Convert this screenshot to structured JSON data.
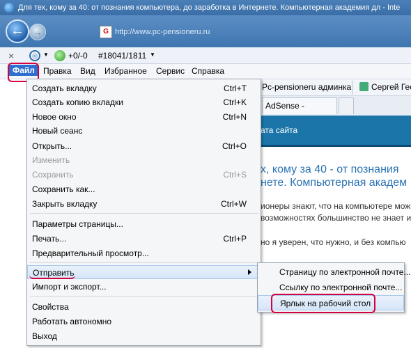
{
  "window": {
    "title": "Для тех, кому за 40: от познания компьютера, до заработка в Интернете. Компьютерная академия дл - Inte",
    "address": "http://www.pc-pensioneru.ru",
    "site_icon": "ie-icon"
  },
  "commandbar": {
    "close": "×",
    "counter": "+0/-0",
    "id_value": "#18041/1811"
  },
  "menubar": {
    "items": [
      "Файл",
      "Правка",
      "Вид",
      "Избранное",
      "Сервис",
      "Справка"
    ]
  },
  "favorites": {
    "items": [
      "Pc-pensioneru админка",
      "Сергей Гес"
    ]
  },
  "tabs": {
    "active_label": "AdSense - Истори..."
  },
  "page_bg": {
    "banner_text": "ата сайта",
    "heading1": "х, кому за 40 - от познания",
    "heading2": "нете. Компьютерная академ",
    "para1": "ионеры знают, что на компьютере мож",
    "para2": "возможностях большинство не знает и у",
    "para3": "но я уверен, что нужно, и без компью"
  },
  "file_menu": {
    "items": [
      {
        "label": "Создать вкладку",
        "shortcut": "Ctrl+T",
        "disabled": false
      },
      {
        "label": "Создать копию вкладки",
        "shortcut": "Ctrl+K",
        "disabled": false
      },
      {
        "label": "Новое окно",
        "shortcut": "Ctrl+N",
        "disabled": false
      },
      {
        "label": "Новый сеанс",
        "shortcut": "",
        "disabled": false
      },
      {
        "label": "Открыть...",
        "shortcut": "Ctrl+O",
        "disabled": false
      },
      {
        "label": "Изменить",
        "shortcut": "",
        "disabled": true
      },
      {
        "label": "Сохранить",
        "shortcut": "Ctrl+S",
        "disabled": true
      },
      {
        "label": "Сохранить как...",
        "shortcut": "",
        "disabled": false
      },
      {
        "label": "Закрыть вкладку",
        "shortcut": "Ctrl+W",
        "disabled": false
      },
      {
        "label": "Параметры страницы...",
        "shortcut": "",
        "disabled": false
      },
      {
        "label": "Печать...",
        "shortcut": "Ctrl+P",
        "disabled": false
      },
      {
        "label": "Предварительный просмотр...",
        "shortcut": "",
        "disabled": false
      },
      {
        "label": "Отправить",
        "shortcut": "",
        "disabled": false
      },
      {
        "label": "Импорт и экспорт...",
        "shortcut": "",
        "disabled": false
      },
      {
        "label": "Свойства",
        "shortcut": "",
        "disabled": false
      },
      {
        "label": "Работать автономно",
        "shortcut": "",
        "disabled": false
      },
      {
        "label": "Выход",
        "shortcut": "",
        "disabled": false
      }
    ]
  },
  "send_submenu": {
    "items": [
      "Страницу по электронной почте...",
      "Ссылку по электронной почте...",
      "Ярлык на рабочий стол"
    ]
  },
  "colors": {
    "menu_highlight": "#d6e6f8",
    "annotation": "#d40040",
    "menubar_active": "#2f6fd0"
  }
}
